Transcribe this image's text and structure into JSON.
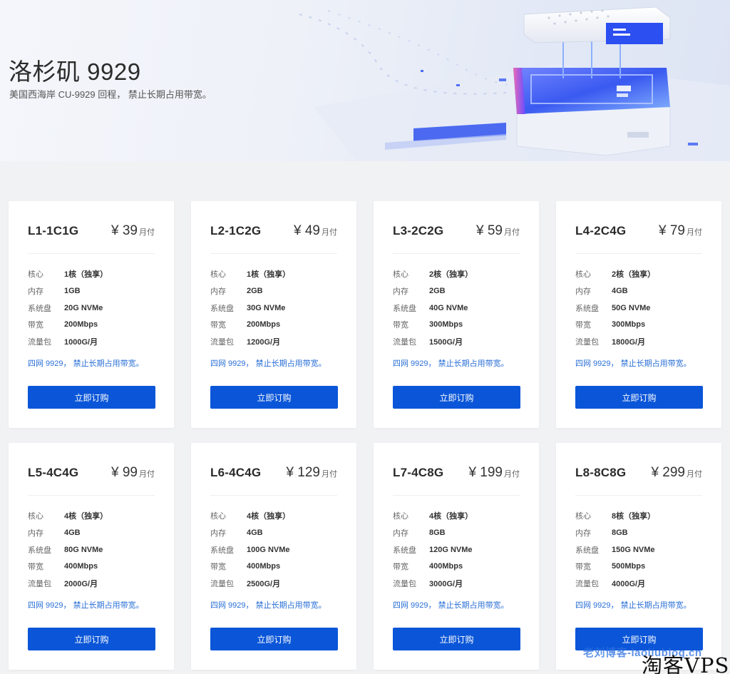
{
  "hero": {
    "title": "洛杉矶 9929",
    "subtitle": "美国西海岸 CU-9929 回程， 禁止长期占用带宽。"
  },
  "labels": {
    "core": "核心",
    "memory": "内存",
    "disk": "系统盘",
    "bandwidth": "带宽",
    "traffic": "流量包"
  },
  "plans": [
    {
      "name": "L1-1C1G",
      "price": "¥ 39",
      "unit": "月付",
      "core": "1核（独享）",
      "memory": "1GB",
      "disk": "20G NVMe",
      "bandwidth": "200Mbps",
      "traffic": "1000G/月",
      "note": "四网 9929， 禁止长期占用带宽。",
      "button": "立即订购"
    },
    {
      "name": "L2-1C2G",
      "price": "¥ 49",
      "unit": "月付",
      "core": "1核（独享）",
      "memory": "2GB",
      "disk": "30G NVMe",
      "bandwidth": "200Mbps",
      "traffic": "1200G/月",
      "note": "四网 9929， 禁止长期占用带宽。",
      "button": "立即订购"
    },
    {
      "name": "L3-2C2G",
      "price": "¥ 59",
      "unit": "月付",
      "core": "2核（独享）",
      "memory": "2GB",
      "disk": "40G NVMe",
      "bandwidth": "300Mbps",
      "traffic": "1500G/月",
      "note": "四网 9929， 禁止长期占用带宽。",
      "button": "立即订购"
    },
    {
      "name": "L4-2C4G",
      "price": "¥ 79",
      "unit": "月付",
      "core": "2核（独享）",
      "memory": "4GB",
      "disk": "50G NVMe",
      "bandwidth": "300Mbps",
      "traffic": "1800G/月",
      "note": "四网 9929， 禁止长期占用带宽。",
      "button": "立即订购"
    },
    {
      "name": "L5-4C4G",
      "price": "¥ 99",
      "unit": "月付",
      "core": "4核（独享）",
      "memory": "4GB",
      "disk": "80G NVMe",
      "bandwidth": "400Mbps",
      "traffic": "2000G/月",
      "note": "四网 9929， 禁止长期占用带宽。",
      "button": "立即订购"
    },
    {
      "name": "L6-4C4G",
      "price": "¥ 129",
      "unit": "月付",
      "core": "4核（独享）",
      "memory": "4GB",
      "disk": "100G NVMe",
      "bandwidth": "400Mbps",
      "traffic": "2500G/月",
      "note": "四网 9929， 禁止长期占用带宽。",
      "button": "立即订购"
    },
    {
      "name": "L7-4C8G",
      "price": "¥ 199",
      "unit": "月付",
      "core": "4核（独享）",
      "memory": "8GB",
      "disk": "120G NVMe",
      "bandwidth": "400Mbps",
      "traffic": "3000G/月",
      "note": "四网 9929， 禁止长期占用带宽。",
      "button": "立即订购"
    },
    {
      "name": "L8-8C8G",
      "price": "¥ 299",
      "unit": "月付",
      "core": "8核（独享）",
      "memory": "8GB",
      "disk": "150G NVMe",
      "bandwidth": "500Mbps",
      "traffic": "4000G/月",
      "note": "四网 9929， 禁止长期占用带宽。",
      "button": "立即订购"
    }
  ],
  "watermark": {
    "blog": "老刘博客-laoliublog.cn",
    "site": "淘客VPS"
  },
  "colors": {
    "accent": "#0b56d8",
    "note": "#2a6fd6",
    "page_bg": "#f1f2f4"
  }
}
